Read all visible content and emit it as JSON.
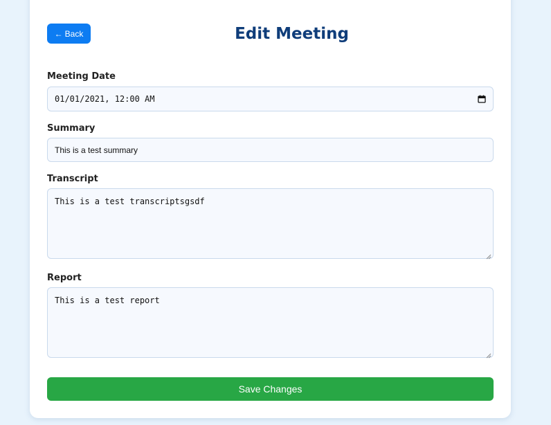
{
  "header": {
    "back_label": "Back",
    "back_icon": "arrow-left-icon",
    "title": "Edit Meeting"
  },
  "form": {
    "meeting_date": {
      "label": "Meeting Date",
      "value": "01/01/2021, 12:00 AM",
      "icon": "calendar-icon"
    },
    "summary": {
      "label": "Summary",
      "value": "This is a test summary"
    },
    "transcript": {
      "label": "Transcript",
      "value": "This is a test transcriptsgsdf"
    },
    "report": {
      "label": "Report",
      "value": "This is a test report"
    },
    "save_label": "Save Changes"
  },
  "colors": {
    "background": "#e8f3fc",
    "title": "#0f3d7a",
    "back_button": "#0d7cf2",
    "save_button": "#28a745",
    "input_bg": "#f6f9fe",
    "input_border": "#c9d9ec"
  }
}
